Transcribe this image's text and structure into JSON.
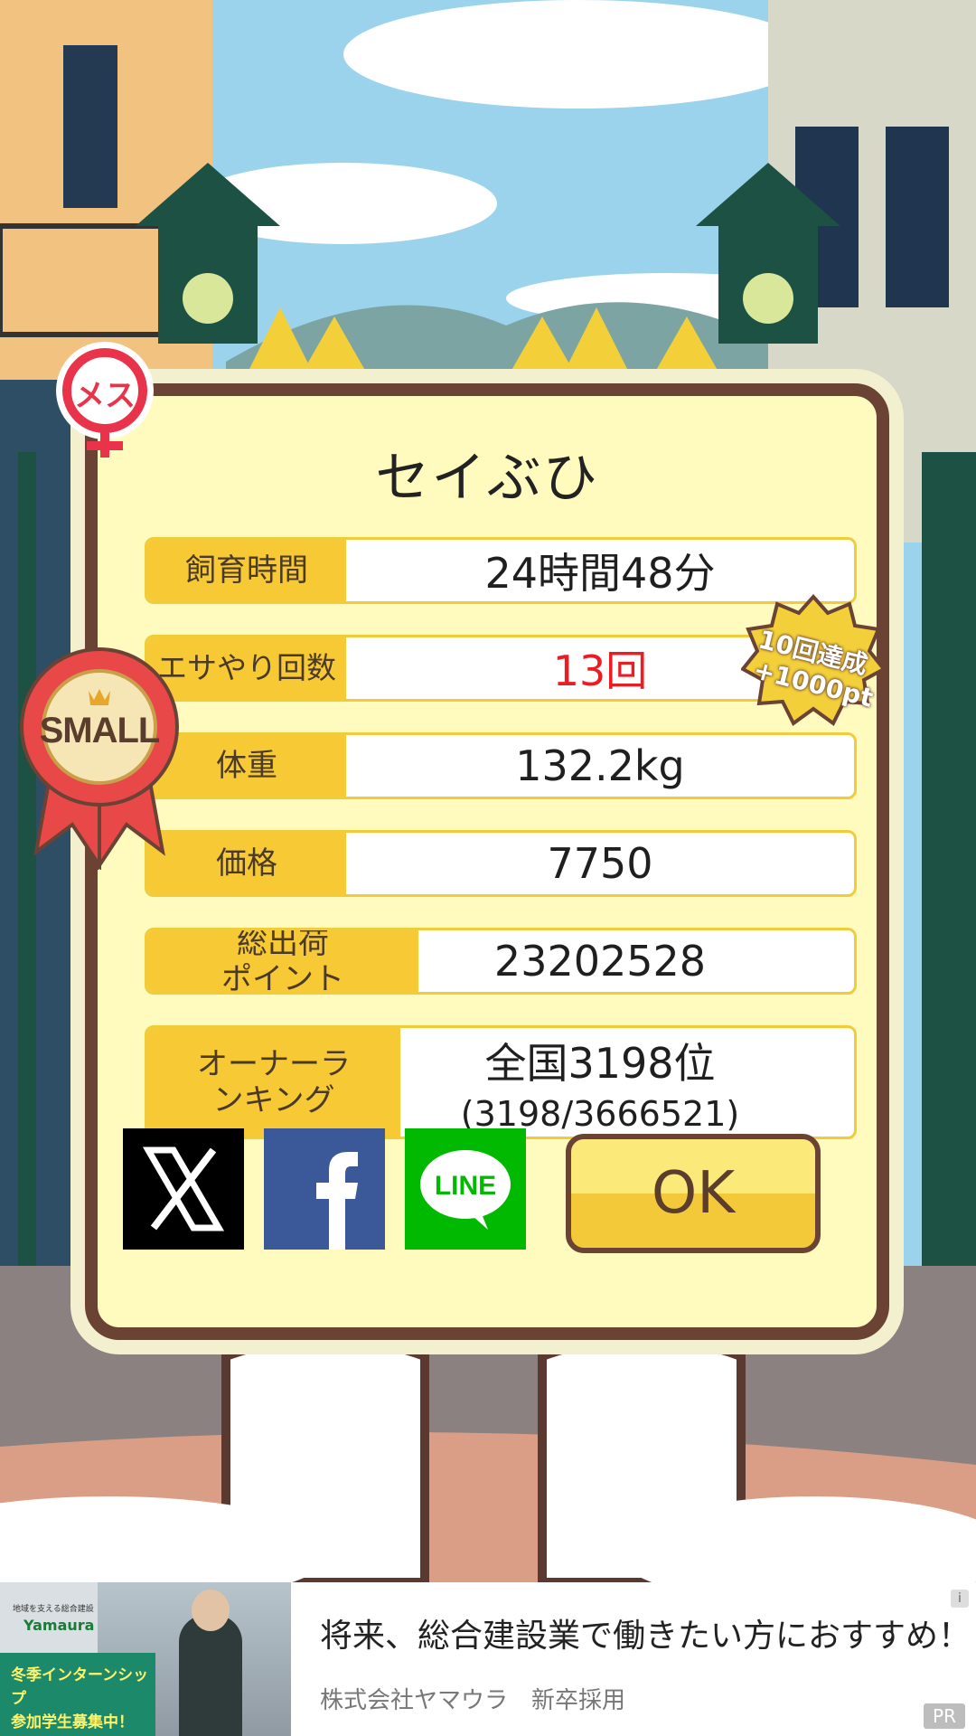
{
  "dialog": {
    "title": "セイぶひ",
    "gender_badge": "メス",
    "size_ribbon": "SMALL",
    "achievement": {
      "line1": "10回達成",
      "line2": "+1000pt"
    },
    "rows": [
      {
        "label": "飼育時間",
        "value": "24時間48分"
      },
      {
        "label": "エサやり回数",
        "value": "13回"
      },
      {
        "label": "体重",
        "value": "132.2kg"
      },
      {
        "label": "価格",
        "value": "7750"
      },
      {
        "label": "総出荷ポイント",
        "value": "23202528"
      },
      {
        "label": "オーナーランキング",
        "value": "全国3198位",
        "sub": "(3198/3666521)"
      }
    ],
    "share": {
      "line_label": "LINE"
    },
    "ok_label": "OK"
  },
  "ad": {
    "headline": "将来、総合建設業で働きたい方におすすめ！",
    "advertiser": "株式会社ヤマウラ　新卒採用",
    "brand": "Yamaura",
    "brand_tagline": "地域を支える総合建設",
    "banner_line1": "冬季インターンシップ",
    "banner_line2": "参加学生募集中！",
    "pr_label": "PR",
    "info_label": "i"
  },
  "colors": {
    "dialog_bg": "#fffbbf",
    "dialog_border": "#6a4334",
    "label_bg": "#f6c935",
    "highlight_red": "#ea1c24",
    "x_brand": "#000000",
    "facebook_brand": "#3b5998",
    "line_brand": "#00b900"
  }
}
